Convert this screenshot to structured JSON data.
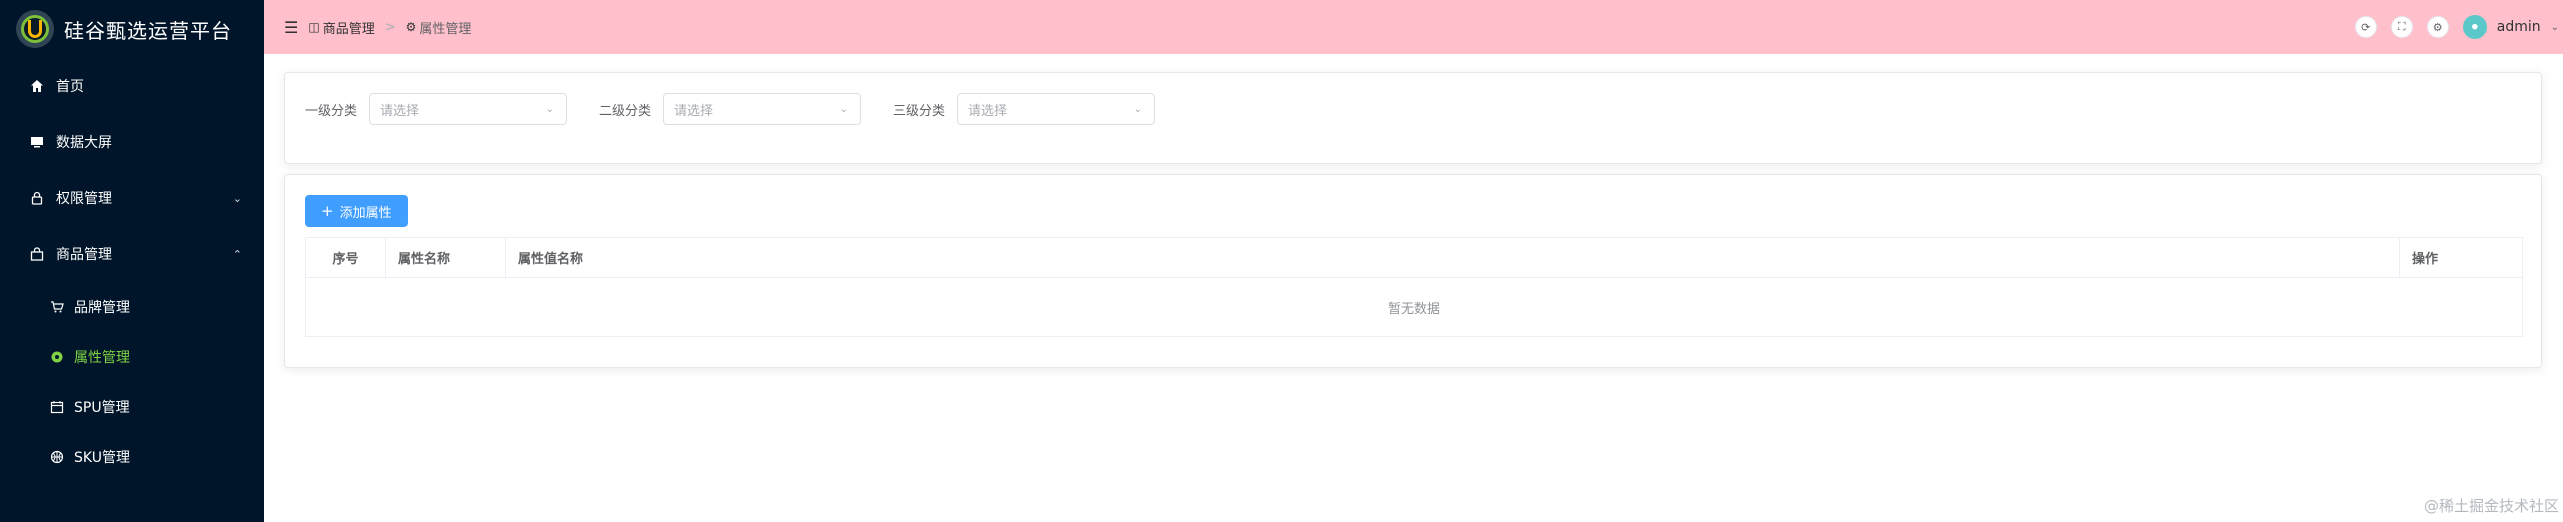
{
  "app": {
    "title": "硅谷甄选运营平台"
  },
  "sidebar": {
    "items": [
      {
        "label": "首页",
        "icon": "home-icon"
      },
      {
        "label": "数据大屏",
        "icon": "monitor-icon"
      },
      {
        "label": "权限管理",
        "icon": "lock-icon"
      },
      {
        "label": "商品管理",
        "icon": "goods-icon"
      }
    ],
    "sub_items": [
      {
        "label": "品牌管理",
        "icon": "cart-icon"
      },
      {
        "label": "属性管理",
        "icon": "settings-icon",
        "active": true
      },
      {
        "label": "SPU管理",
        "icon": "calendar-icon"
      },
      {
        "label": "SKU管理",
        "icon": "basketball-icon"
      }
    ],
    "active_color": "#7fd245",
    "background": "#001529"
  },
  "header": {
    "background": "#ffc0cb",
    "breadcrumb": [
      {
        "label": "商品管理"
      },
      {
        "label": "属性管理"
      }
    ],
    "username": "admin"
  },
  "filters": [
    {
      "label": "一级分类",
      "placeholder": "请选择"
    },
    {
      "label": "二级分类",
      "placeholder": "请选择"
    },
    {
      "label": "三级分类",
      "placeholder": "请选择"
    }
  ],
  "attributes": {
    "add_button_label": "添加属性",
    "columns": [
      "序号",
      "属性名称",
      "属性值名称",
      "操作"
    ],
    "empty_text": "暂无数据"
  },
  "watermark": "@稀土掘金技术社区",
  "colors": {
    "primary": "#409eff"
  }
}
